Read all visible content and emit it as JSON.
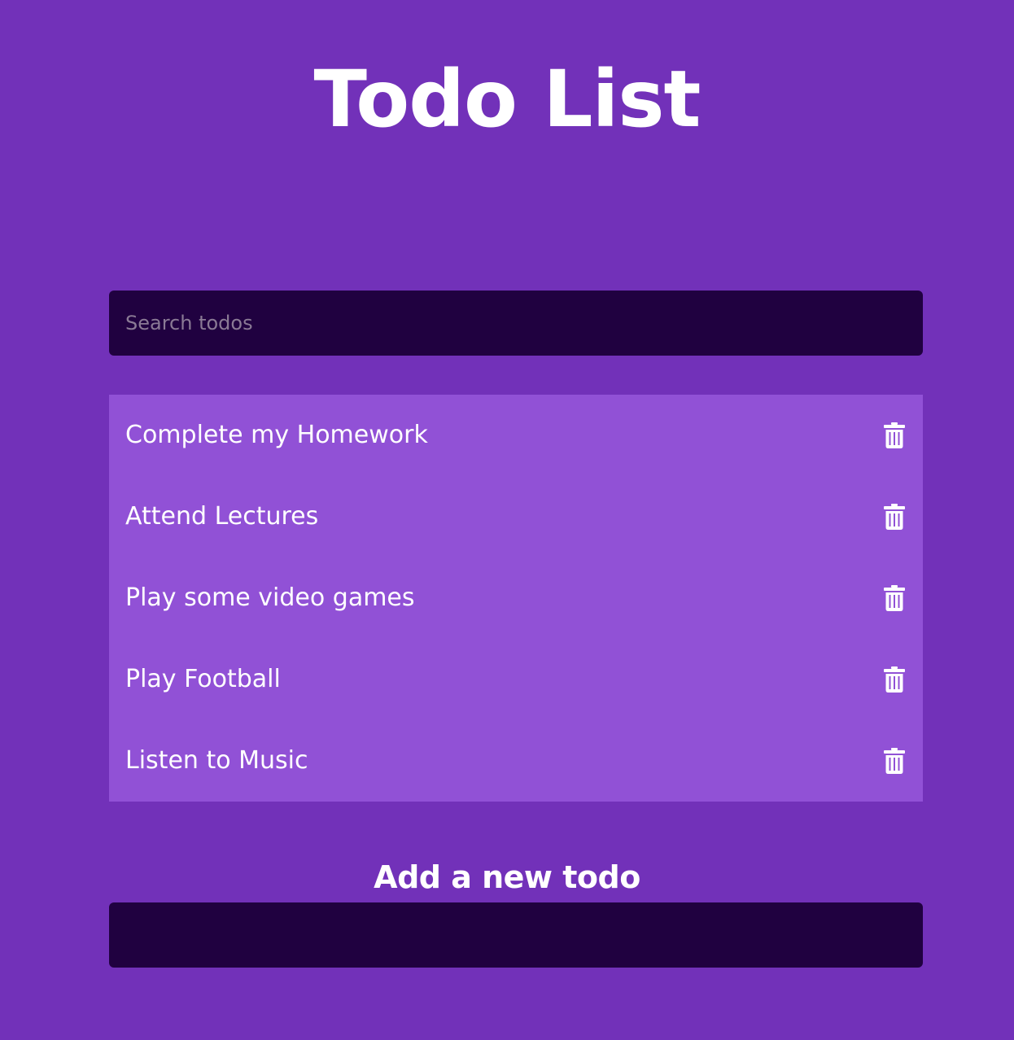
{
  "header": {
    "title": "Todo List"
  },
  "search": {
    "placeholder": "Search todos",
    "value": ""
  },
  "todos": [
    {
      "text": "Complete my Homework",
      "action_icon": "trash-icon"
    },
    {
      "text": "Attend Lectures",
      "action_icon": "trash-icon"
    },
    {
      "text": "Play some video games",
      "action_icon": "trash-icon"
    },
    {
      "text": "Play Football",
      "action_icon": "trash-icon"
    },
    {
      "text": "Listen to Music",
      "action_icon": "trash-icon"
    }
  ],
  "add_form": {
    "heading": "Add a new todo",
    "value": ""
  },
  "colors": {
    "background": "#7231b9",
    "list_background": "#9151d6",
    "input_background": "#200140",
    "text": "#ffffff"
  }
}
